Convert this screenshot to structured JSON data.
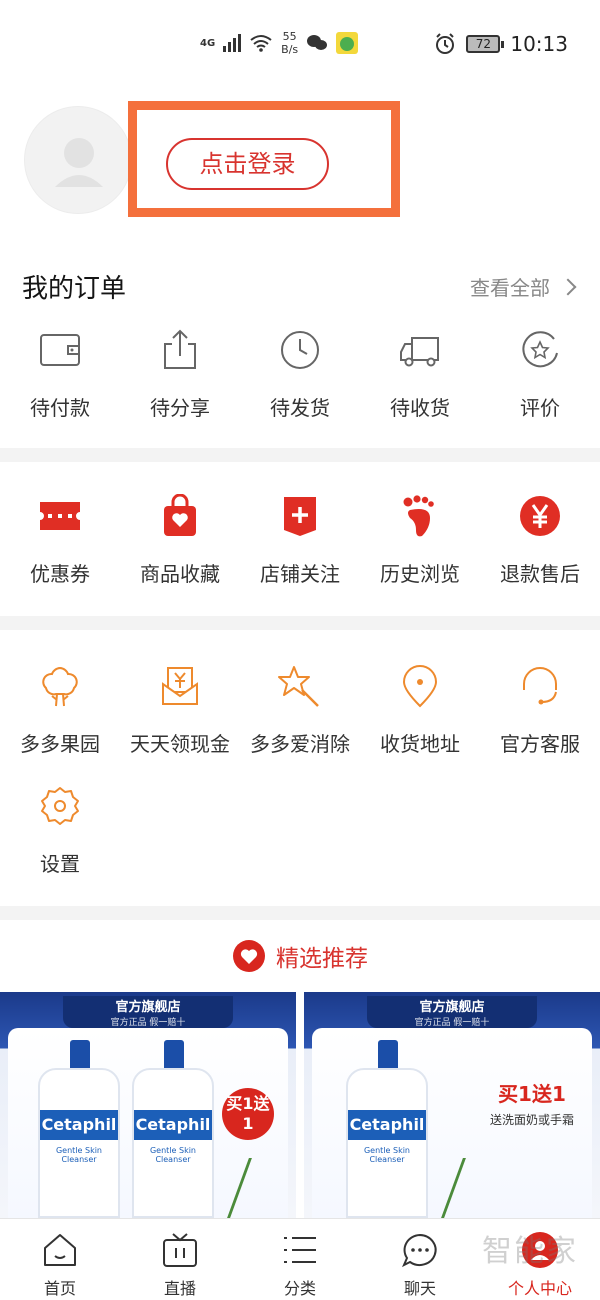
{
  "status_bar": {
    "network": "4G",
    "speed_value": "55",
    "speed_unit": "B/s",
    "battery": "72",
    "time": "10:13"
  },
  "profile": {
    "login_label": "点击登录"
  },
  "orders": {
    "title": "我的订单",
    "view_all": "查看全部",
    "items": [
      {
        "label": "待付款",
        "icon": "wallet-icon"
      },
      {
        "label": "待分享",
        "icon": "share-icon"
      },
      {
        "label": "待发货",
        "icon": "clock-icon"
      },
      {
        "label": "待收货",
        "icon": "truck-icon"
      },
      {
        "label": "评价",
        "icon": "review-icon"
      }
    ]
  },
  "services": {
    "items": [
      {
        "label": "优惠券",
        "icon": "coupon-icon"
      },
      {
        "label": "商品收藏",
        "icon": "favorite-bag-icon"
      },
      {
        "label": "店铺关注",
        "icon": "store-follow-icon"
      },
      {
        "label": "历史浏览",
        "icon": "footprint-icon"
      },
      {
        "label": "退款售后",
        "icon": "refund-icon"
      }
    ]
  },
  "tools": {
    "items": [
      {
        "label": "多多果园",
        "icon": "tree-icon"
      },
      {
        "label": "天天领现金",
        "icon": "cash-icon"
      },
      {
        "label": "多多爱消除",
        "icon": "star-wand-icon"
      },
      {
        "label": "收货地址",
        "icon": "location-icon"
      },
      {
        "label": "官方客服",
        "icon": "headset-icon"
      },
      {
        "label": "设置",
        "icon": "settings-icon"
      }
    ]
  },
  "featured": {
    "label": "精选推荐"
  },
  "products": [
    {
      "store_name": "官方旗舰店",
      "store_sub": "官方正品 假一赔十",
      "brand": "Cetaphil",
      "product_sub": "Gentle Skin Cleanser",
      "promo": "买1送1"
    },
    {
      "store_name": "官方旗舰店",
      "store_sub": "官方正品 假一赔十",
      "brand": "Cetaphil",
      "product_sub": "Gentle Skin Cleanser",
      "promo": "买1送1",
      "promo_sub": "送洗面奶或手霜"
    }
  ],
  "bottom_nav": [
    {
      "label": "首页",
      "icon": "home-icon",
      "active": false
    },
    {
      "label": "直播",
      "icon": "tv-icon",
      "active": false
    },
    {
      "label": "分类",
      "icon": "list-icon",
      "active": false
    },
    {
      "label": "聊天",
      "icon": "chat-icon",
      "active": false
    },
    {
      "label": "个人中心",
      "icon": "profile-icon",
      "active": true
    }
  ],
  "watermark": "智能家",
  "colors": {
    "brand_red": "#d8342f",
    "orange_icon": "#ee8a2d",
    "highlight_orange": "#f4703c"
  }
}
